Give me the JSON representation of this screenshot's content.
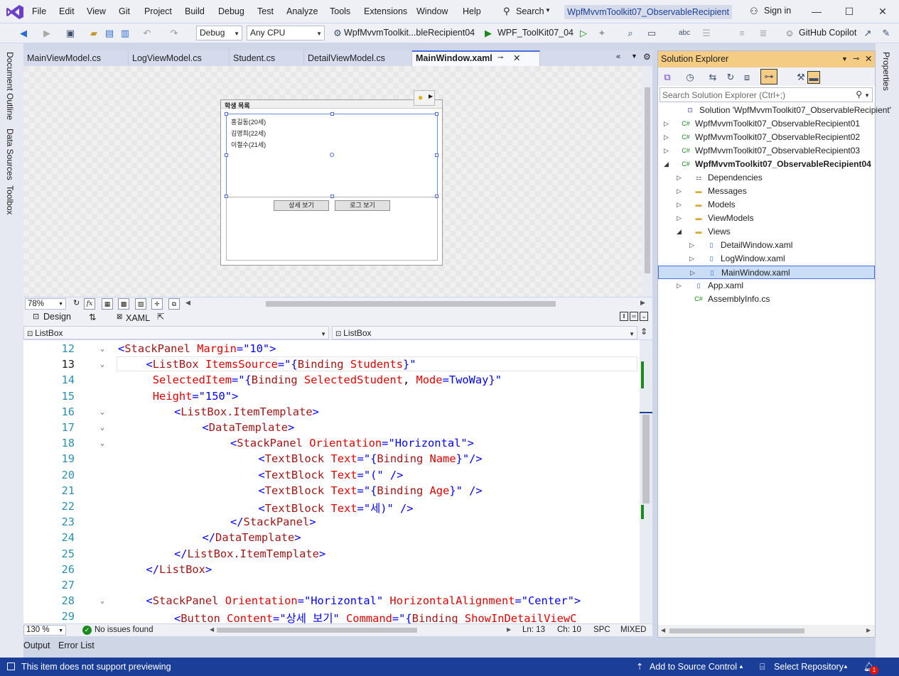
{
  "menubar": {
    "items": [
      "File",
      "Edit",
      "View",
      "Git",
      "Project",
      "Build",
      "Debug",
      "Test",
      "Analyze",
      "Tools",
      "Extensions",
      "Window",
      "Help"
    ],
    "search_label": "Search",
    "window_title": "WpfMvvmToolkit07_ObservableRecipient",
    "sign_in": "Sign in"
  },
  "toolbar": {
    "config": "Debug",
    "platform": "Any CPU",
    "startup_project": "WpfMvvmToolkit...bleRecipient04",
    "run_target": "WPF_ToolKit07_04",
    "copilot": "GitHub Copilot"
  },
  "left_tabs": [
    "Document Outline",
    "Data Sources",
    "Toolbox"
  ],
  "right_tabs": [
    "Properties"
  ],
  "doc_tabs": [
    {
      "label": "MainViewModel.cs"
    },
    {
      "label": "LogViewModel.cs"
    },
    {
      "label": "Student.cs"
    },
    {
      "label": "DetailViewModel.cs"
    },
    {
      "label": "MainWindow.xaml",
      "active": true
    }
  ],
  "designer": {
    "window_title": "학생 목록",
    "list_items": [
      "홍길동(20세)",
      "김영희(22세)",
      "이철수(21세)"
    ],
    "buttons": [
      "상세 보기",
      "로그 보기"
    ],
    "zoom": "78%"
  },
  "split_tabs": {
    "design": "Design",
    "swap": "⇅",
    "xaml": "XAML"
  },
  "combos": {
    "left": "ListBox",
    "right": "ListBox"
  },
  "editor": {
    "current_line": 13,
    "lines": [
      {
        "n": "12",
        "html": "<span class='p'>&lt;</span><span class='t'>StackPanel</span> <span class='a'>Margin</span><span class='p'>=\"10\"&gt;</span>",
        "indent": 1
      },
      {
        "n": "13",
        "html": "<span class='p'>&lt;</span><span class='t'>ListBox</span> <span class='a'>ItemsSource</span><span class='p'>=\"{</span><span class='t'>Binding</span> <span class='a'>Students</span><span class='p'>}\"</span>",
        "indent": 2
      },
      {
        "n": "14",
        "html": " <span class='a'>SelectedItem</span><span class='p'>=\"{</span><span class='t'>Binding</span> <span class='a'>SelectedStudent</span>, <span class='a'>Mode</span><span class='p'>=TwoWay}\"</span>",
        "indent": 2
      },
      {
        "n": "15",
        "html": " <span class='a'>Height</span><span class='p'>=\"150\"&gt;</span>",
        "indent": 2
      },
      {
        "n": "16",
        "html": "<span class='p'>&lt;</span><span class='t'>ListBox.ItemTemplate</span><span class='p'>&gt;</span>",
        "indent": 3
      },
      {
        "n": "17",
        "html": "<span class='p'>&lt;</span><span class='t'>DataTemplate</span><span class='p'>&gt;</span>",
        "indent": 4
      },
      {
        "n": "18",
        "html": "<span class='p'>&lt;</span><span class='t'>StackPanel</span> <span class='a'>Orientation</span><span class='p'>=\"Horizontal\"&gt;</span>",
        "indent": 5
      },
      {
        "n": "19",
        "html": "<span class='p'>&lt;</span><span class='t'>TextBlock</span> <span class='a'>Text</span><span class='p'>=\"{</span><span class='t'>Binding</span> <span class='a'>Name</span><span class='p'>}\"/&gt;</span>",
        "indent": 6
      },
      {
        "n": "20",
        "html": "<span class='p'>&lt;</span><span class='t'>TextBlock</span> <span class='a'>Text</span><span class='p'>=\"(\" /&gt;</span>",
        "indent": 6
      },
      {
        "n": "21",
        "html": "<span class='p'>&lt;</span><span class='t'>TextBlock</span> <span class='a'>Text</span><span class='p'>=\"{</span><span class='t'>Binding</span> <span class='a'>Age</span><span class='p'>}\" /&gt;</span>",
        "indent": 6
      },
      {
        "n": "22",
        "html": "<span class='p'>&lt;</span><span class='t'>TextBlock</span> <span class='a'>Text</span><span class='p'>=\"세)\" /&gt;</span>",
        "indent": 6
      },
      {
        "n": "23",
        "html": "<span class='p'>&lt;/</span><span class='t'>StackPanel</span><span class='p'>&gt;</span>",
        "indent": 5
      },
      {
        "n": "24",
        "html": "<span class='p'>&lt;/</span><span class='t'>DataTemplate</span><span class='p'>&gt;</span>",
        "indent": 4
      },
      {
        "n": "25",
        "html": "<span class='p'>&lt;/</span><span class='t'>ListBox.ItemTemplate</span><span class='p'>&gt;</span>",
        "indent": 3
      },
      {
        "n": "26",
        "html": "<span class='p'>&lt;/</span><span class='t'>ListBox</span><span class='p'>&gt;</span>",
        "indent": 2
      },
      {
        "n": "27",
        "html": "",
        "indent": 2
      },
      {
        "n": "28",
        "html": "<span class='p'>&lt;</span><span class='t'>StackPanel</span> <span class='a'>Orientation</span><span class='p'>=\"Horizontal\"</span> <span class='a'>HorizontalAlignment</span><span class='p'>=\"Center\"&gt;</span>",
        "indent": 2
      },
      {
        "n": "29",
        "html": "<span class='p'>&lt;</span><span class='t'>Button</span> <span class='a'>Content</span><span class='p'>=\"상세 보기\"</span> <span class='a'>Command</span><span class='p'>=\"{</span><span class='t'>Binding</span> <span class='a'>ShowInDetailViewC</span>",
        "indent": 3
      }
    ]
  },
  "editor_status": {
    "zoom": "130 %",
    "issues": "No issues found",
    "line": "Ln: 13",
    "col": "Ch: 10",
    "mode": "SPC",
    "eol": "MIXED"
  },
  "output_tabs": [
    "Output",
    "Error List"
  ],
  "solution_explorer": {
    "title": "Solution Explorer",
    "search_placeholder": "Search Solution Explorer (Ctrl+;)",
    "rows": [
      {
        "label": "Solution 'WpfMvvmToolkit07_ObservableRecipient'",
        "icon": "solution-icon",
        "exp": ""
      },
      {
        "label": "WpfMvvmToolkit07_ObservableRecipient01",
        "icon": "csharp-project-icon",
        "exp": "▷"
      },
      {
        "label": "WpfMvvmToolkit07_ObservableRecipient02",
        "icon": "csharp-project-icon",
        "exp": "▷"
      },
      {
        "label": "WpfMvvmToolkit07_ObservableRecipient03",
        "icon": "csharp-project-icon",
        "exp": "▷"
      },
      {
        "label": "WpfMvvmToolkit07_ObservableRecipient04",
        "icon": "csharp-project-icon",
        "exp": "◢",
        "bold": true
      },
      {
        "label": "Dependencies",
        "icon": "dependencies-icon",
        "exp": "▷"
      },
      {
        "label": "Messages",
        "icon": "folder-icon",
        "exp": "▷"
      },
      {
        "label": "Models",
        "icon": "folder-icon",
        "exp": "▷"
      },
      {
        "label": "ViewModels",
        "icon": "folder-icon",
        "exp": "▷"
      },
      {
        "label": "Views",
        "icon": "folder-open-icon",
        "exp": "◢"
      },
      {
        "label": "DetailWindow.xaml",
        "icon": "xaml-file-icon",
        "exp": "▷"
      },
      {
        "label": "LogWindow.xaml",
        "icon": "xaml-file-icon",
        "exp": "▷"
      },
      {
        "label": "MainWindow.xaml",
        "icon": "xaml-file-icon",
        "exp": "▷",
        "selected": true
      },
      {
        "label": "App.xaml",
        "icon": "xaml-file-icon",
        "exp": "▷"
      },
      {
        "label": "AssemblyInfo.cs",
        "icon": "csharp-file-icon",
        "exp": ""
      }
    ]
  },
  "statusbar": {
    "message": "This item does not support previewing",
    "source_control": "Add to Source Control",
    "repository": "Select Repository",
    "notifications": "1"
  },
  "colors": {
    "accent": "#1b3f99",
    "selection": "#c9ddf6",
    "se_header": "#f5cc84"
  }
}
